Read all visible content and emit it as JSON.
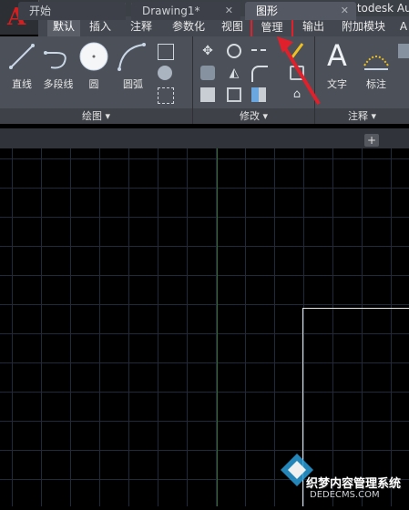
{
  "window": {
    "title": "Autodesk Au"
  },
  "ribbon_tabs": [
    {
      "label": "默认"
    },
    {
      "label": "插入"
    },
    {
      "label": "注释"
    },
    {
      "label": "参数化"
    },
    {
      "label": "视图"
    },
    {
      "label": "管理"
    },
    {
      "label": "输出"
    },
    {
      "label": "附加模块"
    },
    {
      "label": "A"
    }
  ],
  "draw_panel": {
    "title": "绘图 ▾",
    "tools": [
      {
        "label": "直线",
        "icon": "line-icon"
      },
      {
        "label": "多段线",
        "icon": "polyline-icon"
      },
      {
        "label": "圆",
        "icon": "circle-icon"
      },
      {
        "label": "圆弧",
        "icon": "arc-icon"
      }
    ]
  },
  "modify_panel": {
    "title": "修改 ▾"
  },
  "annotation_panel": {
    "title": "注释 ▾",
    "tools": [
      {
        "label": "文字",
        "icon": "text-icon"
      },
      {
        "label": "标注",
        "icon": "dimension-icon"
      }
    ]
  },
  "doc_tabs": [
    {
      "label": "开始"
    },
    {
      "label": "Drawing1*"
    },
    {
      "label": "图形"
    }
  ],
  "watermark": {
    "text": "织梦内容管理系统",
    "url": "DEDECMS.COM"
  },
  "colors": {
    "accent_red": "#e0202a",
    "grid": "#1f2a3a",
    "grid_major": "#2d3a4e",
    "y_axis": "#2a6b2a"
  }
}
